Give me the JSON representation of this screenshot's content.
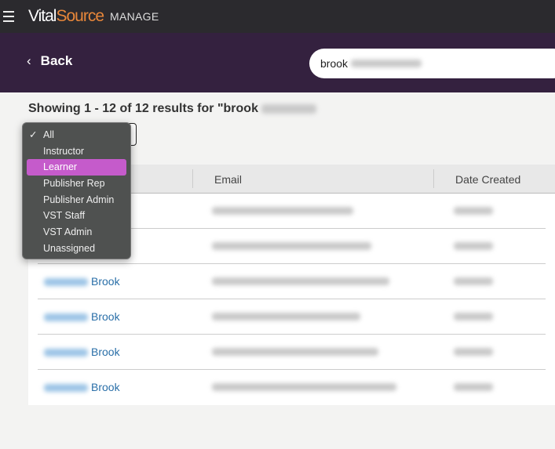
{
  "header": {
    "brand_vital": "Vital",
    "brand_source": "Source",
    "brand_suffix": "MANAGE"
  },
  "nav": {
    "back_label": "Back"
  },
  "search": {
    "value": "brook"
  },
  "results": {
    "summary": "Showing 1 - 12 of 12 results for \"brook"
  },
  "table": {
    "columns": [
      "",
      "Email",
      "Date Created"
    ],
    "rows": [
      {
        "name": ""
      },
      {
        "name": ""
      },
      {
        "name": "Brook"
      },
      {
        "name": "Brook"
      },
      {
        "name": "Brook"
      },
      {
        "name": "Brook"
      }
    ]
  },
  "role_filter": {
    "selected": "All",
    "highlighted": "Learner",
    "options": [
      "All",
      "Instructor",
      "Learner",
      "Publisher Rep",
      "Publisher Admin",
      "VST Staff",
      "VST Admin",
      "Unassigned"
    ]
  },
  "colors": {
    "topbar": "#2b2a2e",
    "band": "#34213f",
    "highlight": "#c55bcb",
    "brand_orange": "#e8873a",
    "link": "#2a6fa8"
  }
}
